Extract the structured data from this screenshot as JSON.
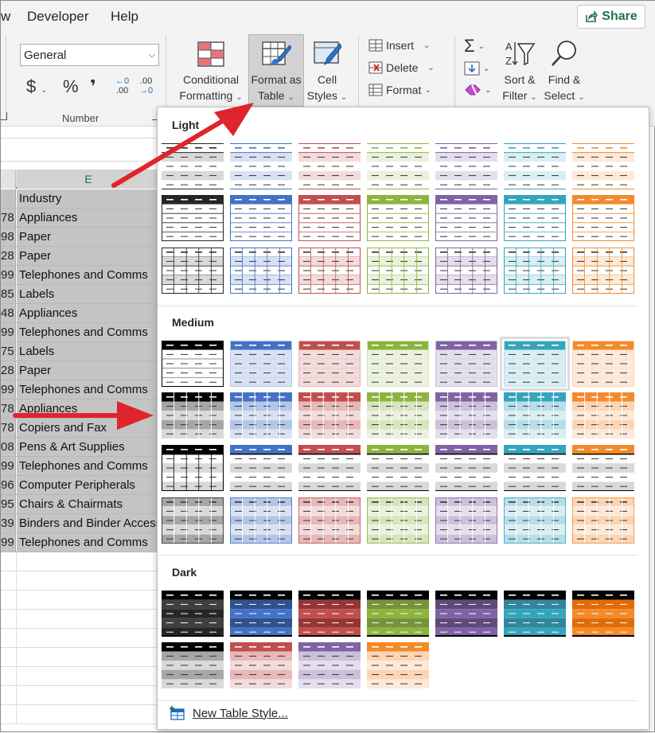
{
  "menu": {
    "partial_item": "w",
    "items": [
      "Developer",
      "Help"
    ],
    "share_label": "Share"
  },
  "ribbon": {
    "number_format_value": "General",
    "currency_symbol": "$",
    "percent_symbol": "%",
    "comma_symbol": "❜",
    "increase_decimal_top": "←0",
    "increase_decimal_bottom": ".00",
    "decrease_decimal_top": ".00",
    "decrease_decimal_bottom": "→0",
    "number_group_label": "Number",
    "conditional_formatting_line1": "Conditional",
    "conditional_formatting_line2": "Formatting",
    "format_as_table_line1": "Format as",
    "format_as_table_line2": "Table",
    "cell_styles_line1": "Cell",
    "cell_styles_line2": "Styles",
    "insert_label": "Insert",
    "delete_label": "Delete",
    "format_label": "Format",
    "sort_filter_line1": "Sort &",
    "sort_filter_line2": "Filter",
    "find_select_line1": "Find &",
    "find_select_line2": "Select"
  },
  "sheet": {
    "column_header": "E",
    "rows": [
      {
        "num": "",
        "value": "Industry"
      },
      {
        "num": "78",
        "value": "Appliances"
      },
      {
        "num": "98",
        "value": "Paper"
      },
      {
        "num": "28",
        "value": "Paper"
      },
      {
        "num": "99",
        "value": "Telephones and Comms"
      },
      {
        "num": "85",
        "value": "Labels"
      },
      {
        "num": "48",
        "value": "Appliances"
      },
      {
        "num": "99",
        "value": "Telephones and Comms"
      },
      {
        "num": "75",
        "value": "Labels"
      },
      {
        "num": "28",
        "value": "Paper"
      },
      {
        "num": "99",
        "value": "Telephones and Comms"
      },
      {
        "num": "78",
        "value": "Appliances"
      },
      {
        "num": "78",
        "value": "Copiers and Fax"
      },
      {
        "num": "08",
        "value": "Pens & Art Supplies"
      },
      {
        "num": "99",
        "value": "Telephones and Comms"
      },
      {
        "num": "96",
        "value": "Computer Peripherals"
      },
      {
        "num": "95",
        "value": "Chairs & Chairmats"
      },
      {
        "num": "39",
        "value": "Binders and Binder Accessories"
      },
      {
        "num": "99",
        "value": "Telephones and Comms"
      }
    ]
  },
  "gallery": {
    "sections": {
      "light": "Light",
      "medium": "Medium",
      "dark": "Dark"
    },
    "new_table_style_label": "New Table Style...",
    "colors": {
      "black": "#262626",
      "blue": "#4472c4",
      "red": "#c0504d",
      "green": "#8db43e",
      "purple": "#7f63a4",
      "teal": "#35a4bd",
      "orange": "#f38a2b",
      "arrow": "#e0242b"
    }
  }
}
